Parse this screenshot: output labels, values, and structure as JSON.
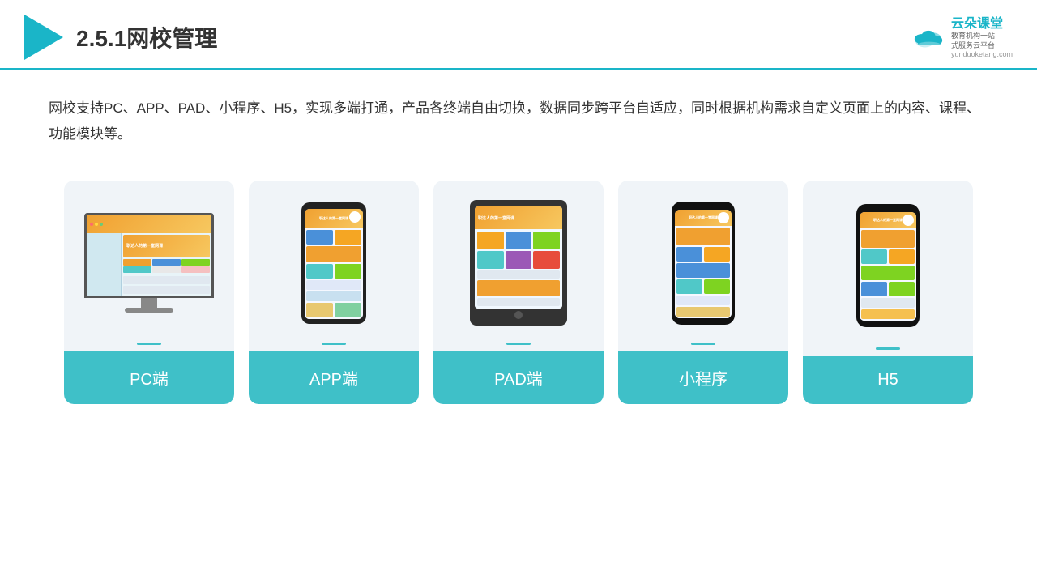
{
  "header": {
    "title": "2.5.1网校管理",
    "brand": {
      "name": "云朵课堂",
      "tagline": "教育机构一站\n式服务云平台",
      "url": "yunduoketang.com"
    }
  },
  "description": "网校支持PC、APP、PAD、小程序、H5，实现多端打通，产品各终端自由切换，数据同步跨平台自适应，同时根据机构需求自定义页面上的内容、课程、功能模块等。",
  "cards": [
    {
      "id": "pc",
      "label": "PC端"
    },
    {
      "id": "app",
      "label": "APP端"
    },
    {
      "id": "pad",
      "label": "PAD端"
    },
    {
      "id": "miniprogram",
      "label": "小程序"
    },
    {
      "id": "h5",
      "label": "H5"
    }
  ],
  "colors": {
    "accent": "#1ab5c8",
    "card_label_bg": "#3fc0c8"
  }
}
